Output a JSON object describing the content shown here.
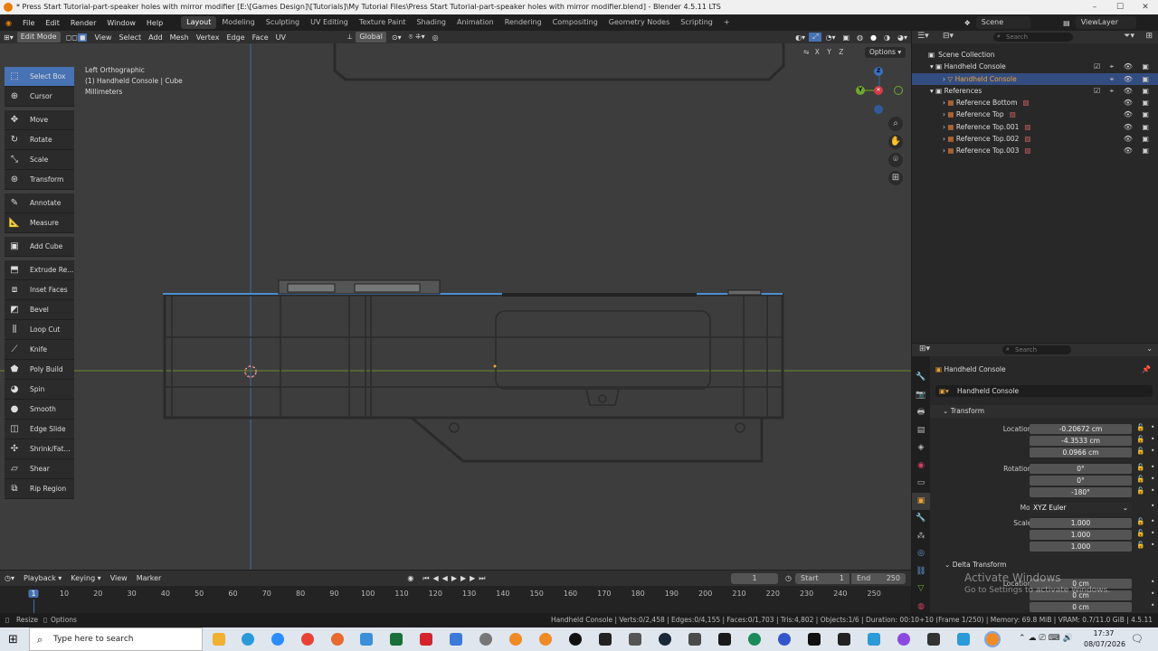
{
  "window": {
    "title": "* Press Start Tutorial-part-speaker holes with mirror modifier [E:\\[Games Design]\\[Tutorials]\\My Tutorial Files\\Press Start Tutorial-part-speaker holes with mirror modifier.blend] - Blender 4.5.11 LTS"
  },
  "menubar": {
    "items": [
      "File",
      "Edit",
      "Render",
      "Window",
      "Help"
    ],
    "workspaces": [
      "Layout",
      "Modeling",
      "Sculpting",
      "UV Editing",
      "Texture Paint",
      "Shading",
      "Animation",
      "Rendering",
      "Compositing",
      "Geometry Nodes",
      "Scripting"
    ],
    "active_workspace": "Layout",
    "scene": "Scene",
    "view_layer": "ViewLayer"
  },
  "viewport_header": {
    "mode": "Edit Mode",
    "menus": [
      "View",
      "Select",
      "Add",
      "Mesh",
      "Vertex",
      "Edge",
      "Face",
      "UV"
    ],
    "orientation": "Global",
    "axes": [
      "X",
      "Y",
      "Z"
    ],
    "options": "Options"
  },
  "viewport": {
    "overlay_lines": [
      "Left Orthographic",
      "(1) Handheld Console | Cube",
      "Millimeters"
    ]
  },
  "toolbar": {
    "tools": [
      {
        "label": "Select Box",
        "icon": "select-box-icon",
        "active": true
      },
      {
        "label": "Cursor",
        "icon": "cursor-icon"
      },
      {
        "label": "Move",
        "icon": "move-icon"
      },
      {
        "label": "Rotate",
        "icon": "rotate-icon"
      },
      {
        "label": "Scale",
        "icon": "scale-icon"
      },
      {
        "label": "Transform",
        "icon": "transform-icon"
      },
      {
        "label": "Annotate",
        "icon": "annotate-icon"
      },
      {
        "label": "Measure",
        "icon": "measure-icon"
      },
      {
        "label": "Add Cube",
        "icon": "add-cube-icon"
      },
      {
        "label": "Extrude Re...",
        "icon": "extrude-icon"
      },
      {
        "label": "Inset Faces",
        "icon": "inset-icon"
      },
      {
        "label": "Bevel",
        "icon": "bevel-icon"
      },
      {
        "label": "Loop Cut",
        "icon": "loop-cut-icon"
      },
      {
        "label": "Knife",
        "icon": "knife-icon"
      },
      {
        "label": "Poly Build",
        "icon": "poly-build-icon"
      },
      {
        "label": "Spin",
        "icon": "spin-icon"
      },
      {
        "label": "Smooth",
        "icon": "smooth-icon"
      },
      {
        "label": "Edge Slide",
        "icon": "edge-slide-icon"
      },
      {
        "label": "Shrink/Fat...",
        "icon": "shrink-fatten-icon"
      },
      {
        "label": "Shear",
        "icon": "shear-icon"
      },
      {
        "label": "Rip Region",
        "icon": "rip-region-icon"
      }
    ]
  },
  "outliner": {
    "search_placeholder": "Search",
    "rows": [
      {
        "label": "Scene Collection"
      },
      {
        "label": "Handheld Console"
      },
      {
        "label": "Handheld Console",
        "selected": true
      },
      {
        "label": "References"
      },
      {
        "label": "Reference Bottom"
      },
      {
        "label": "Reference Top"
      },
      {
        "label": "Reference Top.001"
      },
      {
        "label": "Reference Top.002"
      },
      {
        "label": "Reference Top.003"
      }
    ]
  },
  "properties": {
    "search_placeholder": "Search",
    "object_name": "Handheld Console",
    "datablock": "Handheld Console",
    "transform_label": "Transform",
    "location": {
      "label": "Location X",
      "x": "-0.20672 cm",
      "y": "-4.3533 cm",
      "z": "0.0966 cm"
    },
    "rotation": {
      "label": "Rotation X",
      "x": "0°",
      "y": "0°",
      "z": "-180°"
    },
    "mode": {
      "label": "Mode",
      "value": "XYZ Euler"
    },
    "scale": {
      "label": "Scale X",
      "x": "1.000",
      "y": "1.000",
      "z": "1.000"
    },
    "delta_label": "Delta Transform",
    "delta_location": {
      "label": "Location X",
      "x": "0 cm",
      "y": "0 cm",
      "z": "0 cm"
    },
    "axis_y": "Y",
    "axis_z": "Z"
  },
  "timeline": {
    "menus": [
      "Playback",
      "Keying",
      "View",
      "Marker"
    ],
    "current_frame": "1",
    "start_label": "Start",
    "start": "1",
    "end_label": "End",
    "end": "250",
    "ticks": [
      "1",
      "10",
      "20",
      "30",
      "40",
      "50",
      "60",
      "70",
      "80",
      "90",
      "100",
      "110",
      "120",
      "130",
      "140",
      "150",
      "160",
      "170",
      "180",
      "190",
      "200",
      "210",
      "220",
      "230",
      "240",
      "250"
    ]
  },
  "statusbar": {
    "left": [
      "Resize",
      "Options"
    ],
    "info": "Handheld Console | Verts:0/2,458 | Edges:0/4,155 | Faces:0/1,703 | Tris:4,802 | Objects:1/6 | Duration: 00:10+10 (Frame 1/250) | Memory: 69.8 MiB | VRAM: 0.7/11.0 GiB | 4.5.11"
  },
  "watermark": {
    "line1": "Activate Windows",
    "line2": "Go to Settings to activate Windows."
  },
  "taskbar": {
    "search_placeholder": "Type here to search",
    "time": "17:37",
    "date": "08/07/2026"
  },
  "colors": {
    "accent": "#4772b3",
    "viewport_bg": "#3d3d3d",
    "selected_row": "#334d80",
    "object_name_orange": "#e8a13a"
  }
}
